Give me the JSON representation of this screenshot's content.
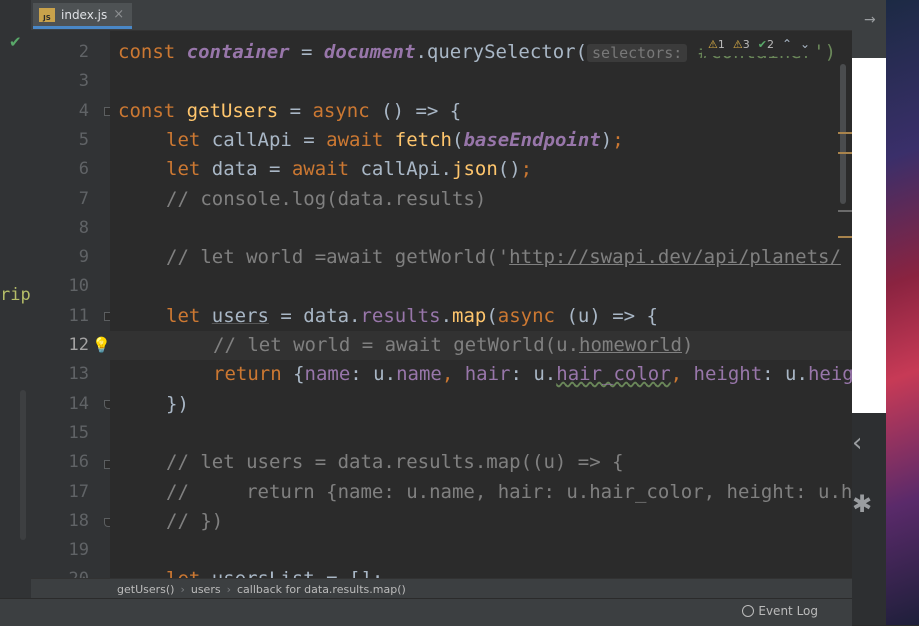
{
  "tab": {
    "icon_text": "JS",
    "file_name": "index.js",
    "close_glyph": "×"
  },
  "gutter": {
    "check_glyph": "✔",
    "side_text": "rip"
  },
  "line_numbers": [
    "2",
    "3",
    "4",
    "5",
    "6",
    "7",
    "8",
    "9",
    "10",
    "11",
    "12",
    "13",
    "14",
    "15",
    "16",
    "17",
    "18",
    "19",
    "20"
  ],
  "current_line": "12",
  "code": {
    "l2": {
      "kw": "const ",
      "var": "container",
      "eq": " = ",
      "doc": "document",
      "call": ".querySelector(",
      "hint": "selectors:",
      "rest": " #container')"
    },
    "l4": {
      "kw": "const ",
      "fn": "getUsers",
      "eq": " = ",
      "async": "async",
      "rest": " () => {"
    },
    "l5": {
      "kw": "let ",
      "name": "callApi = ",
      "await": "await ",
      "fn": "fetch",
      "open": "(",
      "var": "baseEndpoint",
      "close": ")",
      "semi": ";"
    },
    "l6": {
      "kw": "let ",
      "name": "data = ",
      "await": "await ",
      "obj": "callApi.",
      "fn": "json",
      "rest": "()",
      "semi": ";"
    },
    "l7": {
      "comment": "// console.log(data.results)"
    },
    "l9": {
      "comment": "// let world =await getWorld('",
      "link": "http://swapi.dev/api/planets/"
    },
    "l11": {
      "kw": "let ",
      "name": "users",
      "eq": " = data.",
      "prop": "results",
      "dot": ".",
      "fn": "map",
      "open": "(",
      "async": "async",
      "rest": " (u) => {"
    },
    "l12": {
      "comment": "// let world = await getWorld(u.",
      "uline": "homeworld",
      "close": ")"
    },
    "l13": {
      "kw": "return",
      "open": " {",
      "p1": "name",
      "c1": ": u.",
      "p2": "name",
      "comma": ", ",
      "p3": "hair",
      "c2": ": u.",
      "p4": "hair_color",
      "comma2": ", ",
      "p5": "height",
      "c3": ": u.",
      "p6": "height"
    },
    "l14": {
      "text": "})"
    },
    "l16": {
      "comment": "// let users = data.results.map((u) => {"
    },
    "l17": {
      "comment": "//     return {name: u.name, hair: u.hair_color, height: u.height}"
    },
    "l18": {
      "comment": "// })"
    },
    "l20": {
      "kw": "let ",
      "rest": "usersList = [];"
    }
  },
  "inspections": {
    "warn_glyph": "⚠",
    "warnings_a": "1",
    "warnings_b": "3",
    "ok_glyph": "✔",
    "ok_count": "2",
    "up": "⌃",
    "down": "⌄"
  },
  "breadcrumbs": [
    "getUsers()",
    "users",
    "callback for data.results.map()"
  ],
  "status": {
    "event_log": "Event Log"
  },
  "right_panel": {
    "arrow_glyph": "→",
    "chevron_glyph": "‹",
    "gear_glyph": "✱"
  }
}
